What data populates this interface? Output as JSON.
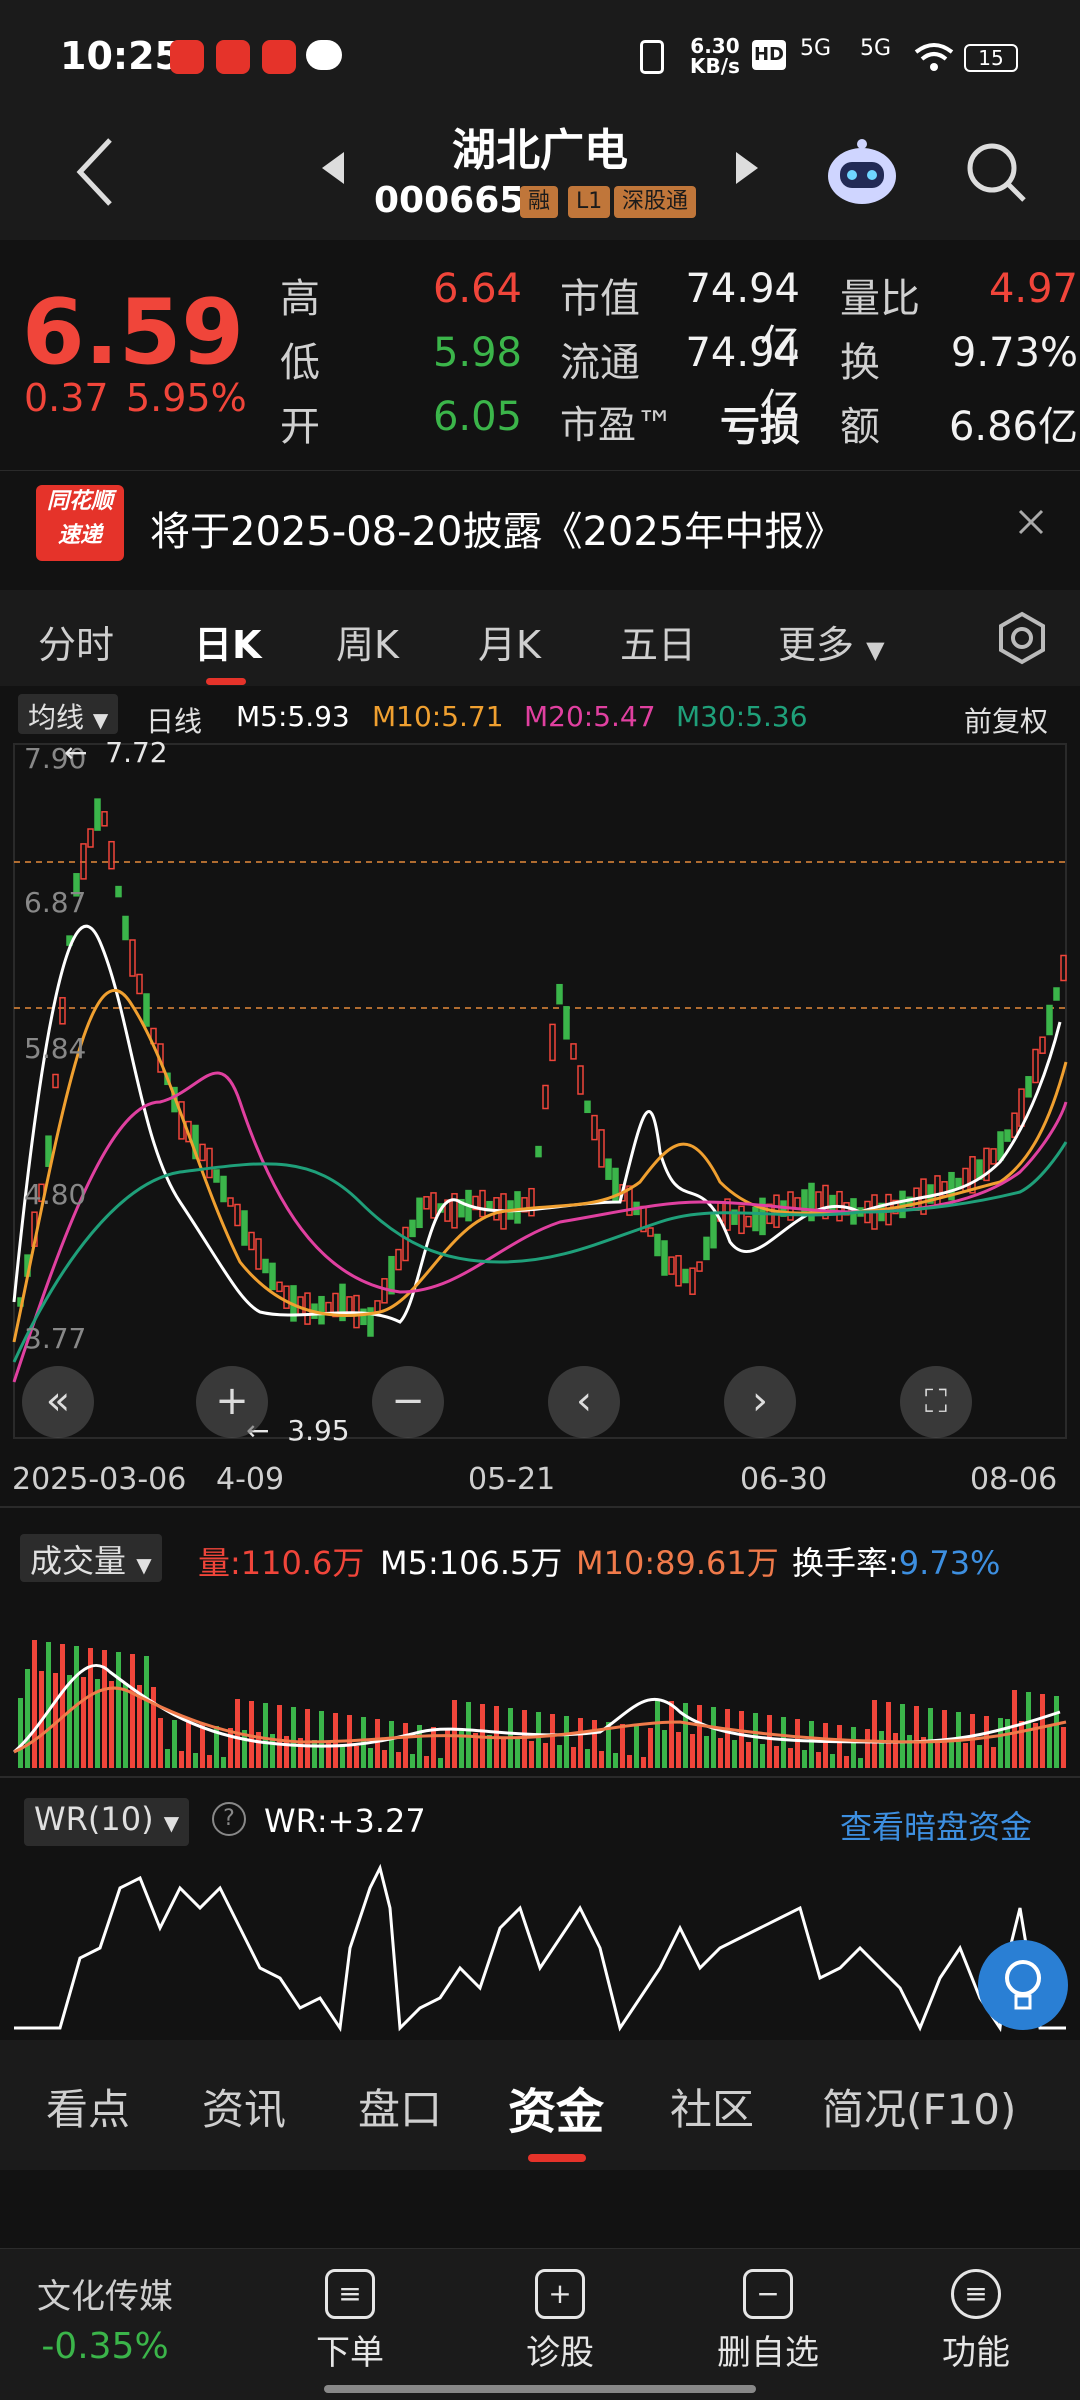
{
  "status": {
    "time": "10:25",
    "net_speed": "6.30",
    "net_unit": "KB/s",
    "signal1": "5G",
    "signal2": "5G",
    "battery": "15",
    "hd": "HD"
  },
  "header": {
    "title": "湖北广电",
    "code": "000665",
    "tags": [
      "融",
      "L1",
      "深股通"
    ]
  },
  "quote": {
    "price": "6.59",
    "change": "0.37",
    "change_pct": "5.95%",
    "high_label": "高",
    "high": "6.64",
    "low_label": "低",
    "low": "5.98",
    "open_label": "开",
    "open": "6.05",
    "mktcap_label": "市值",
    "mktcap": "74.94亿",
    "float_label": "流通",
    "float": "74.94亿",
    "pe_label": "市盈™",
    "pe": "亏损",
    "volratio_label": "量比",
    "volratio": "4.97",
    "turnover_label": "换",
    "turnover": "9.73%",
    "amount_label": "额",
    "amount": "6.86亿"
  },
  "notice": {
    "badge_top": "同花顺",
    "badge_bottom": "速递",
    "text": "将于2025-08-20披露《2025年中报》"
  },
  "tabs": [
    "分时",
    "日K",
    "周K",
    "月K",
    "五日",
    "更多"
  ],
  "active_tab": "日K",
  "kline": {
    "ma_select": "均线",
    "period": "日线",
    "m5": "M5:5.93",
    "m10": "M10:5.71",
    "m20": "M20:5.47",
    "m30": "M30:5.36",
    "adjust": "前复权",
    "y_ticks": [
      "7.90",
      "6.87",
      "5.84",
      "4.80",
      "3.77"
    ],
    "high_marker": "7.72",
    "low_marker": "3.95",
    "dates": [
      "2025-03-06",
      "4-09",
      "05-21",
      "06-30",
      "08-06"
    ]
  },
  "volume": {
    "select": "成交量",
    "vol": "量:110.6万",
    "m5": "M5:106.5万",
    "m10": "M10:89.61万",
    "turnover_label": "换手率:",
    "turnover": "9.73%"
  },
  "wr": {
    "select": "WR(10)",
    "value": "WR:+3.27",
    "link": "查看暗盘资金"
  },
  "bottom_tabs": [
    "看点",
    "资讯",
    "盘口",
    "资金",
    "社区",
    "简况(F10)"
  ],
  "active_bottom_tab": "资金",
  "nav": {
    "sector": "文化传媒",
    "sector_change": "-0.35%",
    "items": [
      {
        "label": "下单",
        "icon": "order-icon"
      },
      {
        "label": "诊股",
        "icon": "diagnose-icon"
      },
      {
        "label": "删自选",
        "icon": "remove-watchlist-icon"
      },
      {
        "label": "功能",
        "icon": "menu-icon"
      }
    ]
  },
  "colors": {
    "up": "#f0453a",
    "down": "#3bb54a",
    "m5": "#ffffff",
    "m10": "#f0a030",
    "m20": "#e040a0",
    "m30": "#1fa07a",
    "accent": "#e5332a",
    "link": "#3d8fe0"
  }
}
